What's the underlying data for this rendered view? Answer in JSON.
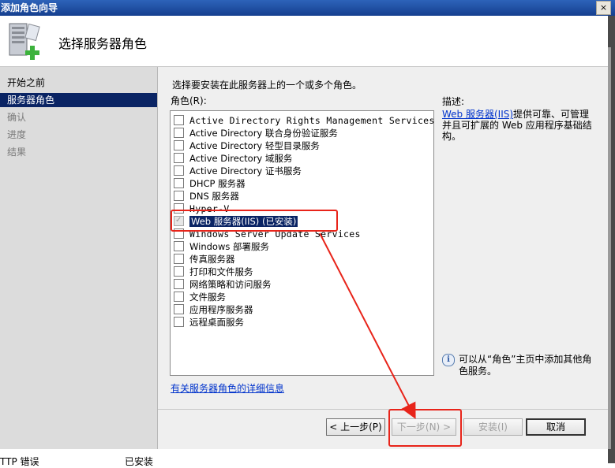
{
  "window": {
    "title": "添加角色向导",
    "close_glyph": "×"
  },
  "header": {
    "title": "选择服务器角色",
    "icon": "server-add-icon"
  },
  "nav": [
    {
      "label": "开始之前",
      "state": "normal"
    },
    {
      "label": "服务器角色",
      "state": "active"
    },
    {
      "label": "确认",
      "state": "disabled"
    },
    {
      "label": "进度",
      "state": "disabled"
    },
    {
      "label": "结果",
      "state": "disabled"
    }
  ],
  "main": {
    "prompt": "选择要安装在此服务器上的一个或多个角色。",
    "roles_label": "角色(R):",
    "roles": [
      {
        "label": "Active Directory Rights Management Services",
        "checked": false
      },
      {
        "label": "Active Directory 联合身份验证服务",
        "checked": false
      },
      {
        "label": "Active Directory 轻型目录服务",
        "checked": false
      },
      {
        "label": "Active Directory 域服务",
        "checked": false
      },
      {
        "label": "Active Directory 证书服务",
        "checked": false
      },
      {
        "label": "DHCP 服务器",
        "checked": false
      },
      {
        "label": "DNS 服务器",
        "checked": false
      },
      {
        "label": "Hyper-V",
        "checked": false
      },
      {
        "label": "Web 服务器(IIS)  (已安装)",
        "checked": true,
        "selected": true
      },
      {
        "label": "Windows Server Update Services",
        "checked": false
      },
      {
        "label": "Windows 部署服务",
        "checked": false
      },
      {
        "label": "传真服务器",
        "checked": false
      },
      {
        "label": "打印和文件服务",
        "checked": false
      },
      {
        "label": "网络策略和访问服务",
        "checked": false
      },
      {
        "label": "文件服务",
        "checked": false
      },
      {
        "label": "应用程序服务器",
        "checked": false
      },
      {
        "label": "远程桌面服务",
        "checked": false
      }
    ],
    "more_info_link": "有关服务器角色的详细信息"
  },
  "description": {
    "label": "描述:",
    "link": "Web 服务器(IIS)",
    "text": "提供可靠、可管理并且可扩展的 Web 应用程序基础结构。"
  },
  "info": {
    "icon": "info-icon",
    "text": "可以从“角色”主页中添加其他角色服务。"
  },
  "buttons": {
    "back": "< 上一步(P)",
    "next": "下一步(N) >",
    "install": "安装(I)",
    "cancel": "取消"
  },
  "background": {
    "row_left": "TTP 错误",
    "row_right": "已安装"
  },
  "colors": {
    "annotation_red": "#e8241a",
    "selection": "#0a2464"
  }
}
